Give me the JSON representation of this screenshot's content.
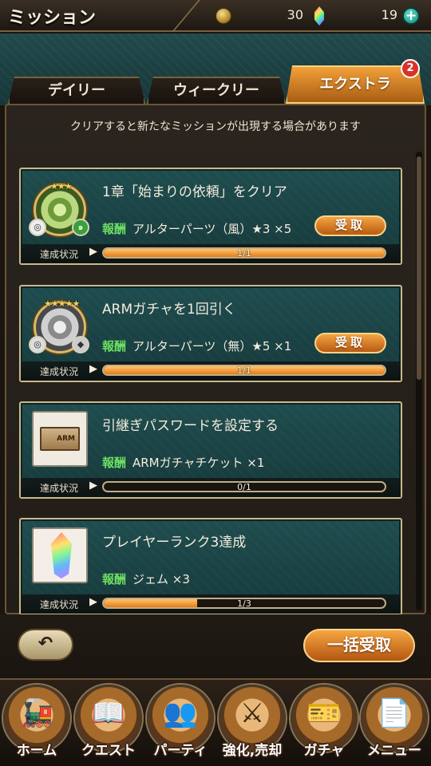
{
  "header": {
    "title": "ミッション",
    "coins": "30",
    "gems": "19",
    "plus_icon": "plus-icon"
  },
  "tabs": [
    {
      "label": "デイリー",
      "active": false
    },
    {
      "label": "ウィークリー",
      "active": false
    },
    {
      "label": "エクストラ",
      "active": true,
      "badge": "2"
    }
  ],
  "notice": "クリアすると新たなミッションが出現する場合があります",
  "missions": [
    {
      "title": "1章「始まりの依頼」をクリア",
      "reward_label": "報酬",
      "reward": "アルターパーツ（風）★3 ×5",
      "claim_label": "受取",
      "status_label": "達成状況",
      "progress_text": "1/1",
      "progress": 1.0,
      "stars": "★★★",
      "icon": "green-medal-icon"
    },
    {
      "title": "ARMガチャを1回引く",
      "reward_label": "報酬",
      "reward": "アルターパーツ（無）★5 ×1",
      "claim_label": "受取",
      "status_label": "達成状況",
      "progress_text": "1/1",
      "progress": 1.0,
      "stars": "★★★★★",
      "icon": "silver-medal-icon"
    },
    {
      "title": "引継ぎパスワードを設定する",
      "reward_label": "報酬",
      "reward": "ARMガチャチケット ×1",
      "status_label": "達成状況",
      "progress_text": "0/1",
      "progress": 0.0,
      "icon": "gacha-ticket-icon",
      "ticket_text": "ARM"
    },
    {
      "title": "プレイヤーランク3達成",
      "reward_label": "報酬",
      "reward": "ジェム ×3",
      "status_label": "達成状況",
      "progress_text": "1/3",
      "progress": 0.333,
      "icon": "gem-crystal-icon"
    }
  ],
  "controls": {
    "back_glyph": "↶",
    "bulk_claim": "一括受取"
  },
  "nav": [
    {
      "label": "ホーム",
      "icon": "train-icon",
      "glyph": "🚂"
    },
    {
      "label": "クエスト",
      "icon": "book-icon",
      "glyph": "📖"
    },
    {
      "label": "パーティ",
      "icon": "party-icon",
      "glyph": "👥"
    },
    {
      "label": "強化,売却",
      "icon": "swords-icon",
      "glyph": "⚔"
    },
    {
      "label": "ガチャ",
      "icon": "gacha-icon",
      "glyph": "🎫"
    },
    {
      "label": "メニュー",
      "icon": "menu-icon",
      "glyph": "📄"
    }
  ]
}
